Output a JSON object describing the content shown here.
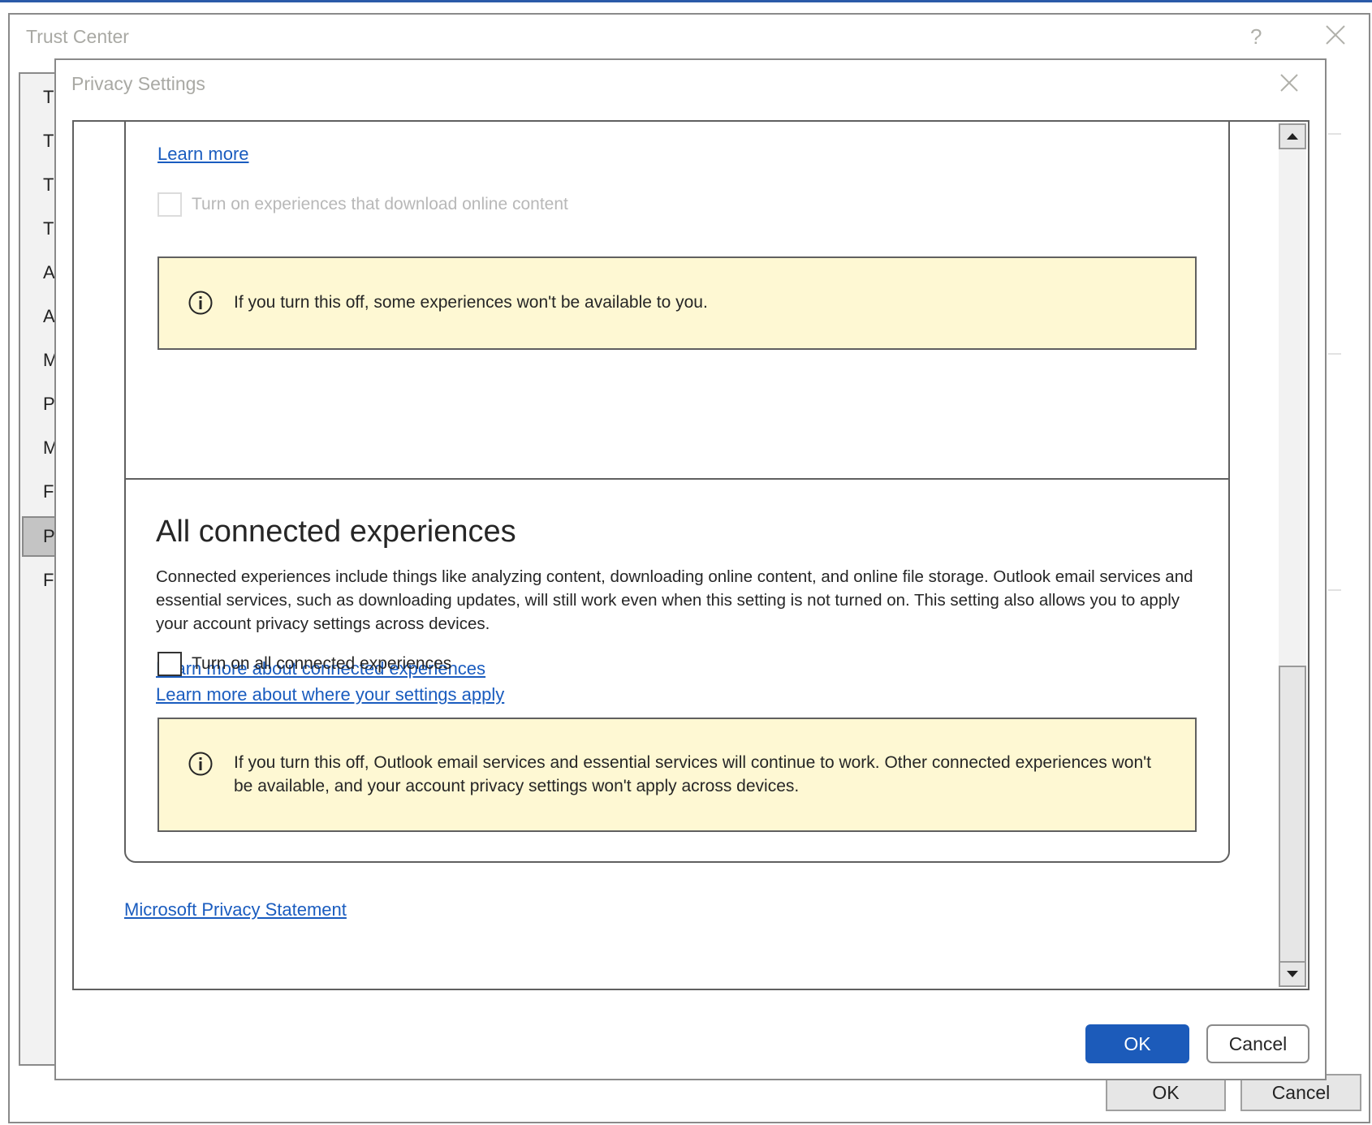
{
  "colors": {
    "accent": "#1c5bba",
    "link": "#1a5cbf",
    "info_bg": "#fef8d3"
  },
  "trust_center": {
    "title": "Trust Center",
    "help_icon": "question-icon",
    "close_icon": "close-icon",
    "sidebar_items": [
      "Tr",
      "Tr",
      "Tr",
      "Tr",
      "A",
      "A",
      "M",
      "P",
      "M",
      "Fi",
      "P",
      "Fo"
    ],
    "selected_index": 10,
    "ok_label": "OK",
    "cancel_label": "Cancel"
  },
  "privacy_settings": {
    "title": "Privacy Settings",
    "close_icon": "close-icon",
    "download_section": {
      "learn_more": "Learn more",
      "checkbox_label": "Turn on experiences that download online content",
      "checkbox_checked": false,
      "checkbox_disabled": true,
      "info_text": "If you turn this off, some experiences won't be available to you."
    },
    "all_connected": {
      "heading": "All connected experiences",
      "description": "Connected experiences include things like analyzing content, downloading online content, and online file storage. Outlook email services and essential services, such as downloading updates, will still work even when this setting is not turned on. This setting also allows you to apply your account privacy settings across devices.",
      "link1": "Learn more about connected experiences",
      "link2": "Learn more about where your settings apply",
      "checkbox_label": "Turn on all connected experiences",
      "checkbox_checked": false,
      "info_text": "If you turn this off, Outlook email services and essential services will continue to work. Other connected experiences won't be available, and your account privacy settings won't apply across devices."
    },
    "privacy_statement": "Microsoft Privacy Statement",
    "ok_label": "OK",
    "cancel_label": "Cancel"
  }
}
